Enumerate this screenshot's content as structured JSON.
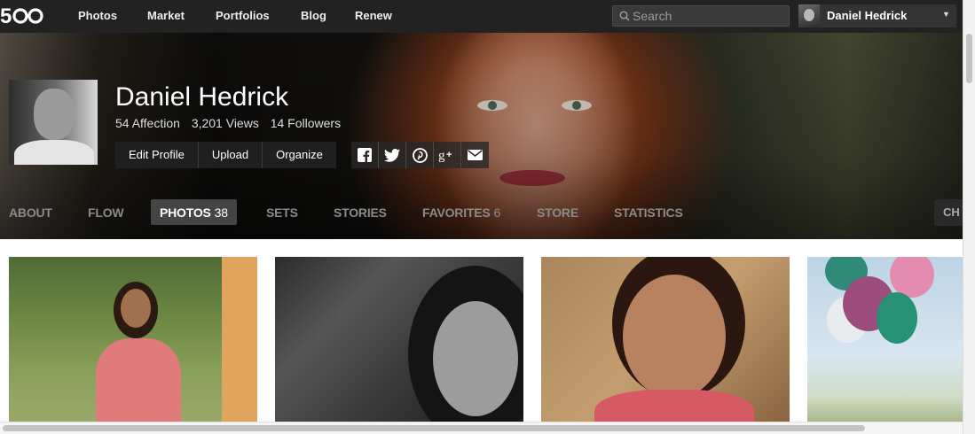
{
  "topnav": {
    "brand": "500px",
    "links": [
      "Photos",
      "Market",
      "Portfolios",
      "Blog",
      "Renew"
    ],
    "search_placeholder": "Search",
    "user_name": "Daniel Hedrick"
  },
  "profile": {
    "name": "Daniel Hedrick",
    "affection": "54 Affection",
    "views": "3,201 Views",
    "followers": "14 Followers",
    "buttons": [
      "Edit Profile",
      "Upload",
      "Organize"
    ],
    "social_icons": [
      "facebook-icon",
      "twitter-icon",
      "pinterest-icon",
      "google-plus-icon",
      "email-icon"
    ]
  },
  "tabs": [
    {
      "label": "ABOUT",
      "count": ""
    },
    {
      "label": "FLOW",
      "count": ""
    },
    {
      "label": "PHOTOS",
      "count": "38"
    },
    {
      "label": "SETS",
      "count": ""
    },
    {
      "label": "STORIES",
      "count": ""
    },
    {
      "label": "FAVORITES",
      "count": "6"
    },
    {
      "label": "STORE",
      "count": ""
    },
    {
      "label": "STATISTICS",
      "count": ""
    }
  ],
  "tab_more_label": "CH",
  "active_tab": "PHOTOS",
  "colors": {
    "topbar": "#222222",
    "active_tab": "#444444",
    "tab_text": "#8a8a8a"
  }
}
